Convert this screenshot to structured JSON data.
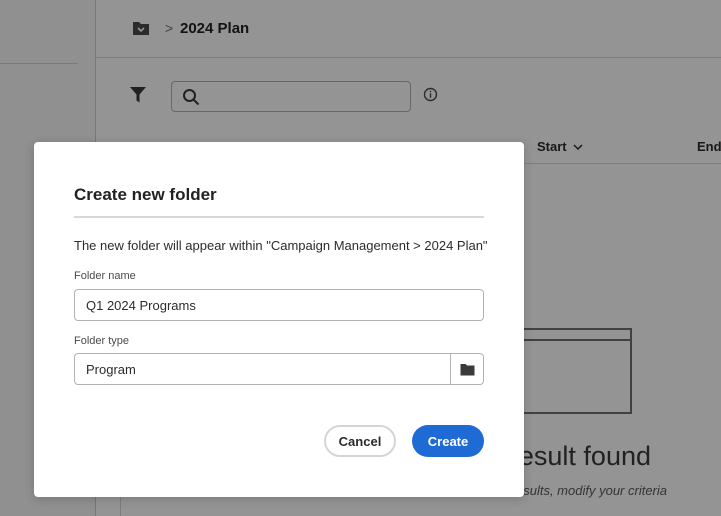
{
  "breadcrumb": {
    "separator": ">",
    "current": "2024 Plan"
  },
  "search": {
    "placeholder": "",
    "value": ""
  },
  "table": {
    "columns": [
      "Start",
      "End"
    ]
  },
  "empty_state": {
    "title": "result found",
    "subtitle": "esults, modify your criteria"
  },
  "dialog": {
    "title": "Create new folder",
    "description": "The new folder will appear within \"Campaign Management > 2024 Plan\"",
    "folder_name": {
      "label": "Folder name",
      "value": "Q1 2024 Programs"
    },
    "folder_type": {
      "label": "Folder type",
      "value": "Program"
    },
    "buttons": {
      "cancel": "Cancel",
      "create": "Create"
    }
  },
  "colors": {
    "accent": "#1f6bd6",
    "overlay": "rgba(0,0,0,0.42)"
  },
  "icons": [
    "folder-icon",
    "chevron-right-icon",
    "filter-icon",
    "search-icon",
    "info-icon",
    "chevron-down-icon",
    "folder-picker-icon"
  ]
}
